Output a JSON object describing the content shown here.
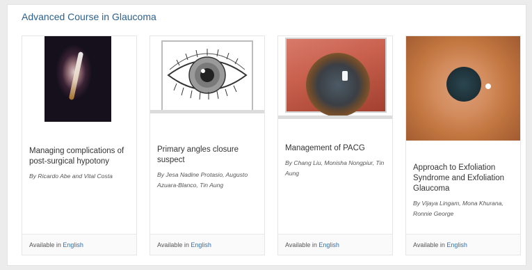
{
  "section": {
    "title": "Advanced Course in Glaucoma"
  },
  "cards": [
    {
      "title": "Managing complications of post-surgical hypotony",
      "authors": "By Ricardo Abe and Vital Costa",
      "available_prefix": "Available in",
      "language": "English"
    },
    {
      "title": "Primary angles closure suspect",
      "authors": "By Jesa Nadine Protasio, Augusto Azuara-Blanco, Tin Aung",
      "available_prefix": "Available in",
      "language": "English"
    },
    {
      "title": "Management of PACG",
      "authors": "By Chang Liu, Monisha Nongpiur, Tin Aung",
      "available_prefix": "Available in",
      "language": "English"
    },
    {
      "title": "Approach to Exfoliation Syndrome and Exfoliation Glaucoma",
      "authors": "By Vijaya Lingam, Mona Khurana, Ronnie George",
      "available_prefix": "Available in",
      "language": "English"
    }
  ],
  "colors": {
    "title_blue": "#2c5f8a",
    "link_blue": "#2c6fb5"
  }
}
